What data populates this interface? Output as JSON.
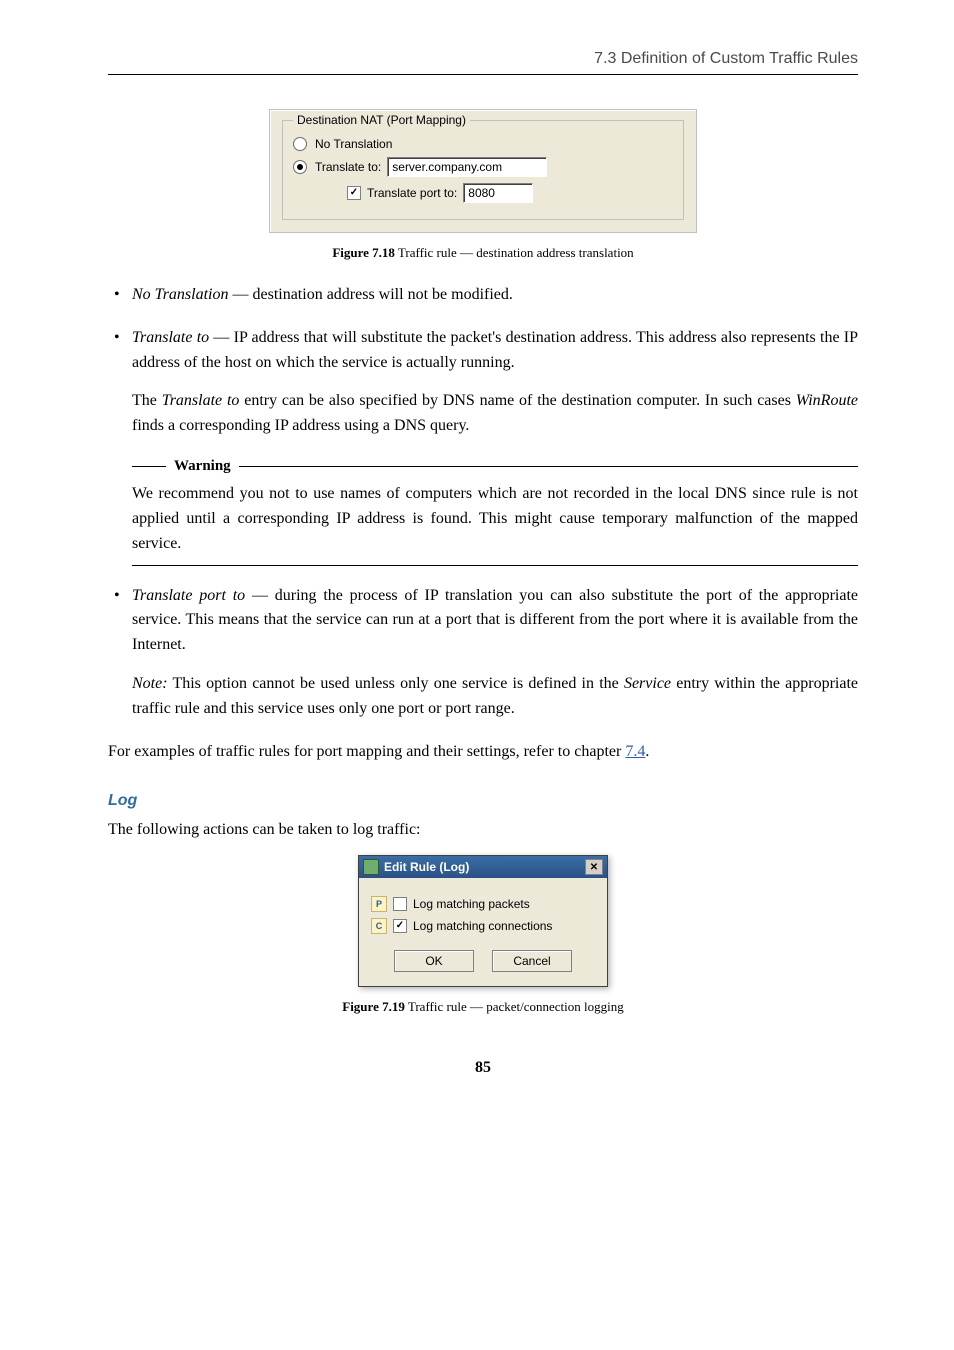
{
  "running_head": "7.3 Definition of Custom Traffic Rules",
  "fig18": {
    "legend": "Destination NAT (Port Mapping)",
    "radio_no_translation": "No Translation",
    "radio_translate_to": "Translate to:",
    "translate_to_value": "server.company.com",
    "chk_translate_port": "Translate port to:",
    "translate_port_value": "8080",
    "caption_bold": "Figure 7.18",
    "caption_rest": "  Traffic rule — destination address translation"
  },
  "bullets": {
    "b1_term": "No Translation",
    "b1_text": " — destination address will not be modified.",
    "b2_term": "Translate to",
    "b2_text": " — IP address that will substitute the packet's destination address. This address also represents the IP address of the host on which the service is actually running.",
    "b2_p2_a": "The ",
    "b2_p2_term1": "Translate to",
    "b2_p2_b": " entry can be also specified by DNS name of the destination computer. In such cases ",
    "b2_p2_term2": "WinRoute",
    "b2_p2_c": " finds a corresponding IP address using a DNS query.",
    "warn_label": "Warning",
    "warn_body": "We recommend you not to use names of computers which are not recorded in the local DNS since rule is not applied until a corresponding IP address is found. This might cause temporary malfunction of the mapped service.",
    "b3_term": "Translate port to",
    "b3_text": " — during the process of IP translation you can also substitute the port of the appropriate service. This means that the service can run at a port that is different from the port where it is available from the Internet.",
    "b3_note_label": "Note:",
    "b3_note_a": " This option cannot be used unless only one service is defined in the ",
    "b3_note_term": "Service",
    "b3_note_b": " entry within the appropriate traffic rule and this service uses only one port or port range."
  },
  "closing_a": "For examples of traffic rules for port mapping and their settings, refer to chapter ",
  "closing_link": "7.4",
  "closing_b": ".",
  "log_heading": "Log",
  "log_intro": "The following actions can be taken to log traffic:",
  "fig19": {
    "title": "Edit Rule (Log)",
    "icon_p": "P",
    "icon_c": "C",
    "chk1_label": "Log matching packets",
    "chk2_label": "Log matching connections",
    "btn_ok": "OK",
    "btn_cancel": "Cancel",
    "caption_bold": "Figure 7.19",
    "caption_rest": "  Traffic rule — packet/connection logging"
  },
  "page_number": "85"
}
